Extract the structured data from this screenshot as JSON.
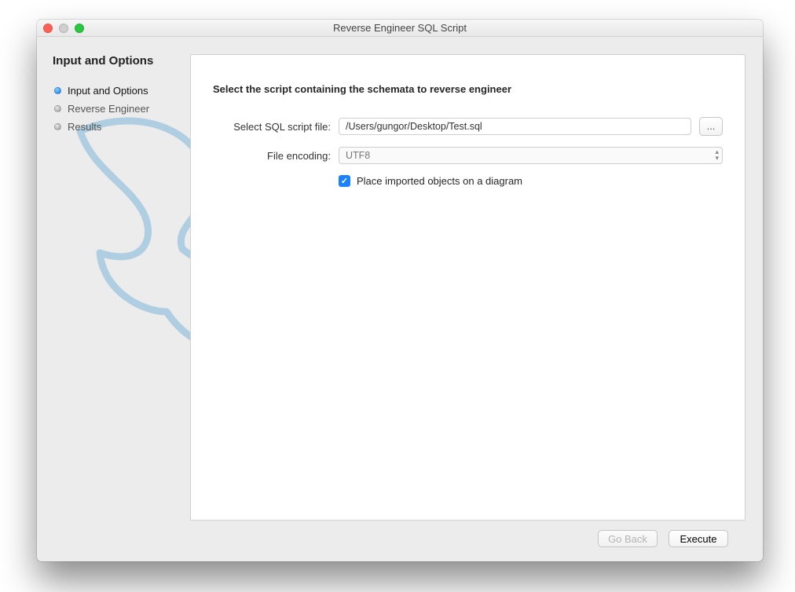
{
  "window": {
    "title": "Reverse Engineer SQL Script"
  },
  "sidebar": {
    "header": "Input and Options",
    "steps": [
      {
        "label": "Input and Options",
        "selected": true
      },
      {
        "label": "Reverse Engineer",
        "selected": false
      },
      {
        "label": "Results",
        "selected": false
      }
    ]
  },
  "main": {
    "section_title": "Select the script containing the schemata to reverse engineer",
    "script_label": "Select SQL script file:",
    "script_value": "/Users/gungor/Desktop/Test.sql",
    "browse_label": "...",
    "encoding_label": "File encoding:",
    "encoding_value": "UTF8",
    "checkbox_label": "Place imported objects on a diagram",
    "checkbox_checked": true
  },
  "footer": {
    "back_label": "Go Back",
    "back_enabled": false,
    "exec_label": "Execute"
  }
}
